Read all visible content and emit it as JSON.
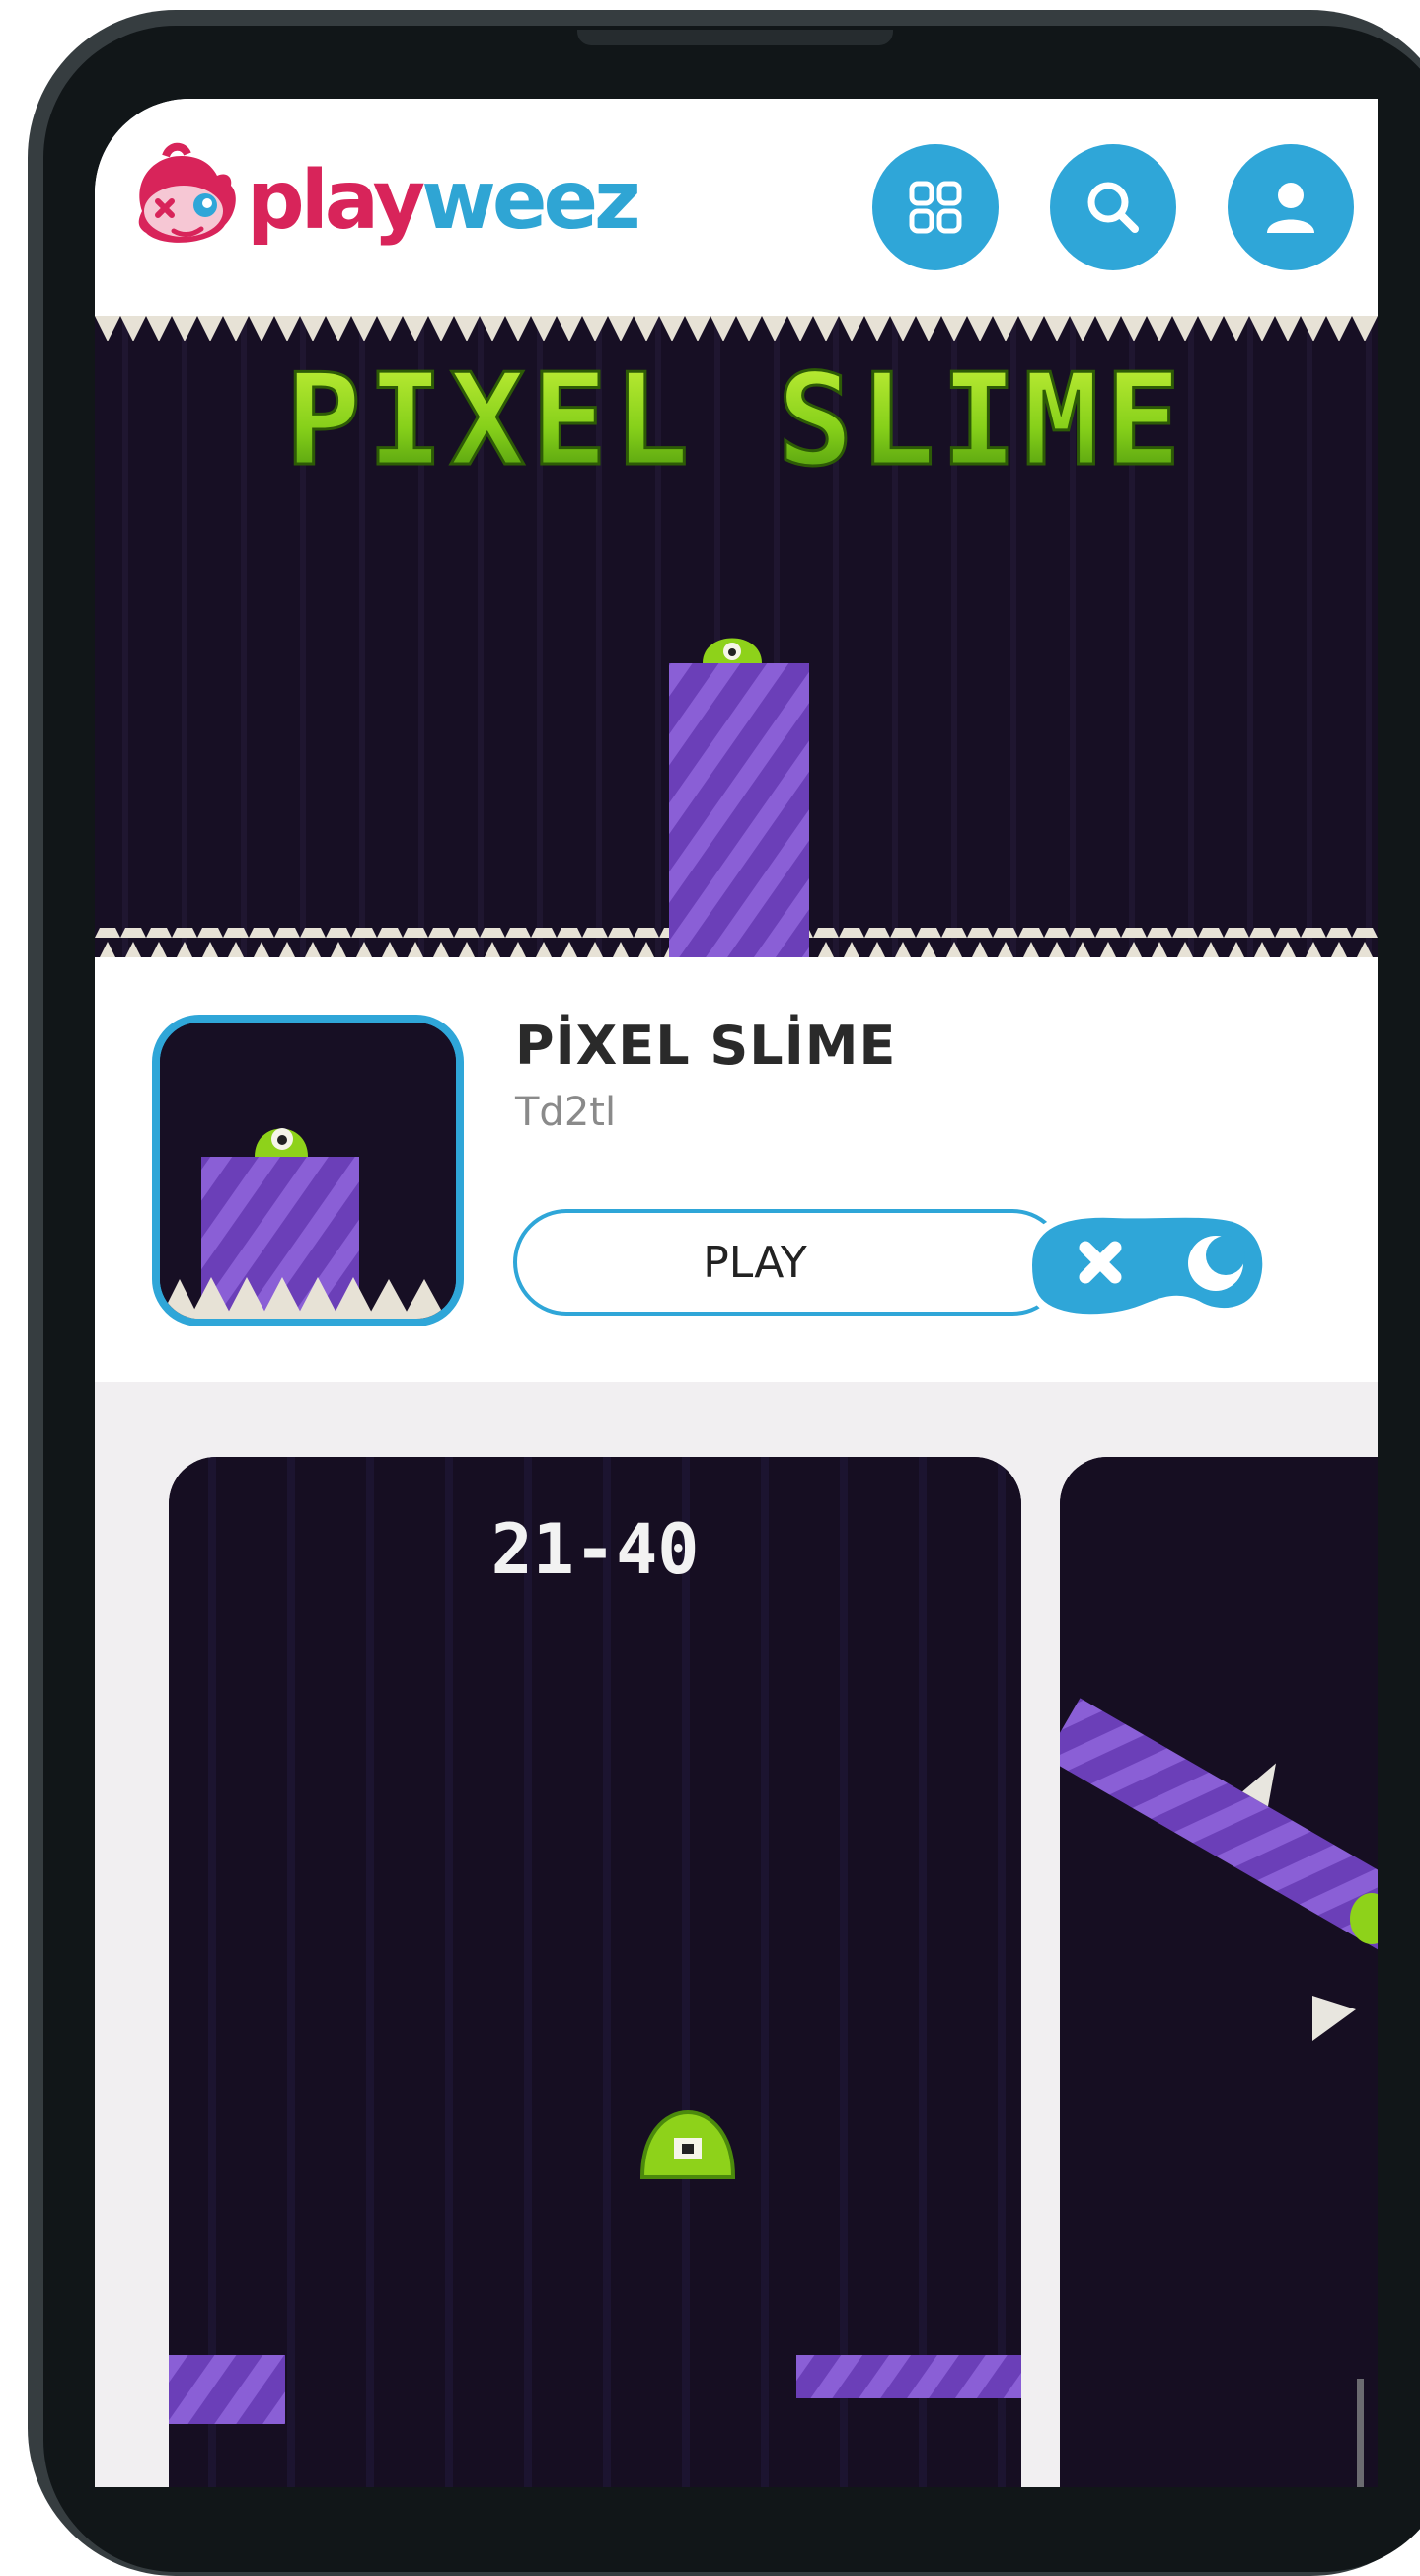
{
  "header": {
    "logo_play": "play",
    "logo_weez": "weez",
    "buttons": [
      "categories-icon",
      "search-icon",
      "user-icon"
    ]
  },
  "hero": {
    "banner_title": "PIXEL SLIME"
  },
  "game": {
    "title": "PİXEL SLİME",
    "subtitle": "Td2tl",
    "play_label": "PLAY"
  },
  "gallery": {
    "screenshot1_level": "21-40"
  },
  "colors": {
    "brand_pink": "#d8245a",
    "brand_blue": "#2fa6d8",
    "game_bg": "#160e22",
    "slime_green": "#8ed21a",
    "platform_purple": "#7a4fc4"
  }
}
